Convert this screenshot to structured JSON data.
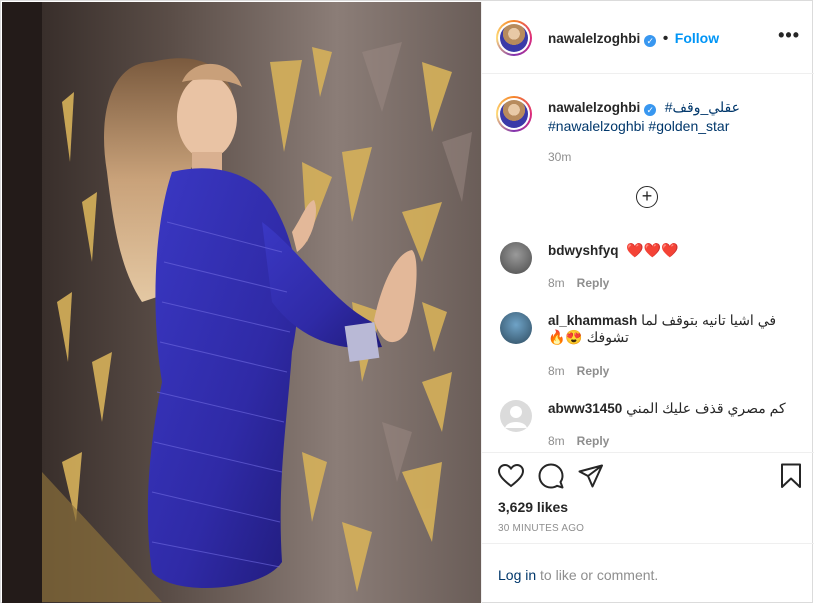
{
  "post": {
    "username": "nawalelzoghbi",
    "follow_label": "Follow",
    "more_icon": "more-dots-icon"
  },
  "caption": {
    "username": "nawalelzoghbi",
    "hashtag_arabic": "#عقلي_وقف",
    "hashtags_latin": "#nawalelzoghbi #golden_star",
    "time": "30m"
  },
  "comments": [
    {
      "username": "bdwyshfyq",
      "text": "❤️❤️❤️",
      "time": "8m",
      "reply_label": "Reply"
    },
    {
      "username": "al_khammash",
      "text": "في اشيا تانيه بتوقف لما تشوفك 😍🔥",
      "time": "8m",
      "reply_label": "Reply"
    },
    {
      "username": "abww31450",
      "text": "كم مصري قذف عليك المني",
      "time": "8m",
      "reply_label": "Reply"
    }
  ],
  "likes": "3,629 likes",
  "posted_ago": "30 MINUTES AGO",
  "login": {
    "link": "Log in",
    "rest": " to like or comment."
  },
  "colors": {
    "accent": "#0095f6",
    "dress": "#3a36b8",
    "wall": "#7a6c66",
    "gold": "#d8b45e"
  }
}
